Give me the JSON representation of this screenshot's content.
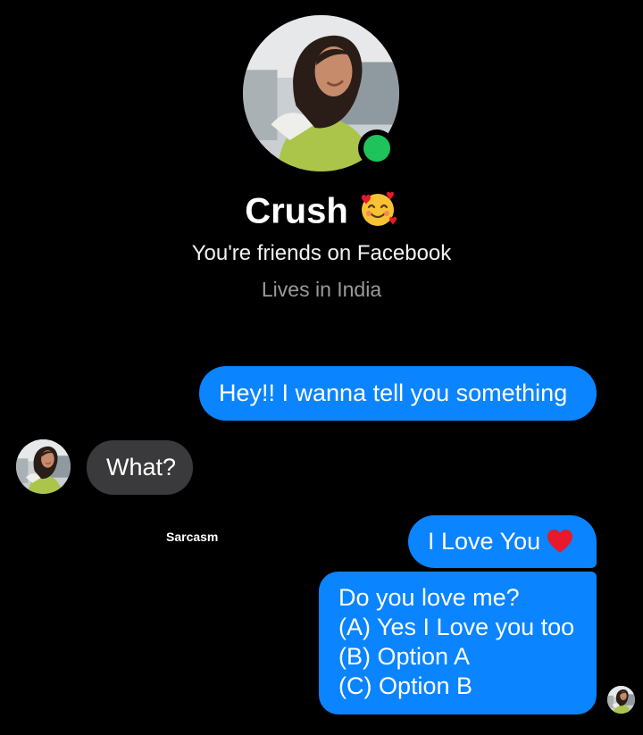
{
  "profile": {
    "name": "Crush",
    "name_emoji": "smiling-face-with-hearts-icon",
    "friends_text": "You're friends on Facebook",
    "location_text": "Lives in India",
    "online": true
  },
  "messages": [
    {
      "direction": "outgoing",
      "text": "Hey!! I wanna tell you something"
    },
    {
      "direction": "incoming",
      "text": "What?"
    },
    {
      "direction": "outgoing",
      "text": "I Love You",
      "icon": "heart-icon"
    },
    {
      "direction": "outgoing",
      "lines": [
        "Do you love me?",
        "(A) Yes I Love you too",
        "(B) Option A",
        "(C) Option B"
      ]
    }
  ],
  "watermark": "Sarcasm",
  "colors": {
    "background": "#000000",
    "outgoing_bubble": "#0a84ff",
    "incoming_bubble": "#3a3a3c",
    "online": "#1fc35c",
    "heart": "#e8192c"
  }
}
